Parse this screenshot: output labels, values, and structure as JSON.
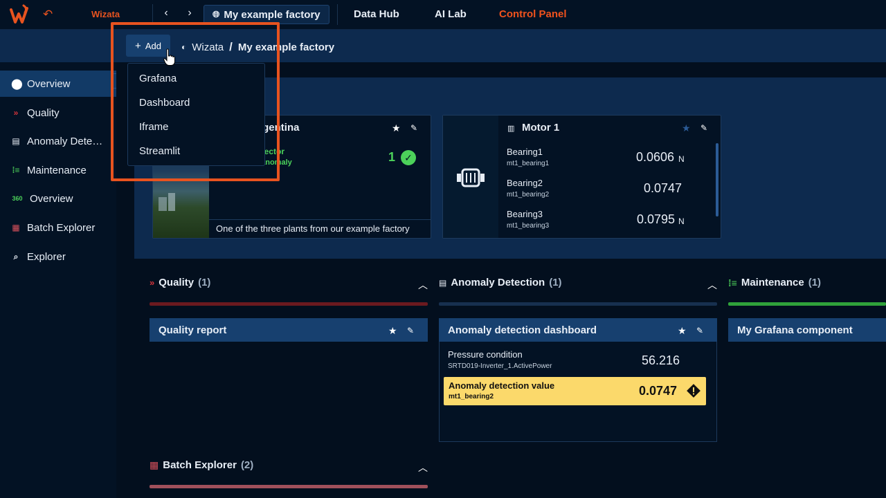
{
  "topbar": {
    "brand": "Wizata",
    "factory": "My example factory",
    "nav": [
      "Data Hub",
      "AI Lab",
      "Control Panel"
    ],
    "accent": "#f0521d"
  },
  "subbar": {
    "add_label": "Add",
    "crumb_root": "Wizata",
    "crumb_sep": "/",
    "crumb_current": "My example factory"
  },
  "dropdown": {
    "items": [
      "Grafana",
      "Dashboard",
      "Iframe",
      "Streamlit"
    ]
  },
  "sidebar": {
    "items": [
      {
        "label": "Overview",
        "icon": "location-pin-icon"
      },
      {
        "label": "Quality",
        "icon": "chevron-double-down-icon"
      },
      {
        "label": "Anomaly Dete…",
        "icon": "anomaly-icon"
      },
      {
        "label": "Maintenance",
        "icon": "maintenance-icon"
      },
      {
        "label": "Overview",
        "icon": "360-icon"
      },
      {
        "label": "Batch Explorer",
        "icon": "batch-icon"
      },
      {
        "label": "Explorer",
        "icon": "explorer-icon"
      }
    ]
  },
  "plant_card": {
    "title": "A: Argentina",
    "tag1": "etector",
    "tag2": "_anomaly",
    "count": "1",
    "description": "One of the three plants from our example factory"
  },
  "motor_card": {
    "title": "Motor 1",
    "metrics": [
      {
        "name": "Bearing1",
        "sub": "mt1_bearing1",
        "value": "0.0606",
        "unit": "N"
      },
      {
        "name": "Bearing2",
        "sub": "mt1_bearing2",
        "value": "0.0747",
        "unit": ""
      },
      {
        "name": "Bearing3",
        "sub": "mt1_bearing3",
        "value": "0.0795",
        "unit": "N"
      }
    ]
  },
  "sections": {
    "quality": {
      "title": "Quality",
      "count": "(1)",
      "color": "#6b1a1f"
    },
    "anomaly": {
      "title": "Anomaly Detection",
      "count": "(1)",
      "color": "#17304f"
    },
    "maintenance": {
      "title": "Maintenance",
      "count": "(1)",
      "color": "#2fa23a"
    },
    "batch": {
      "title": "Batch Explorer",
      "count": "(2)",
      "color": "#a0505b"
    }
  },
  "panels": {
    "quality_report": {
      "title": "Quality report"
    },
    "anomaly_dashboard": {
      "title": "Anomaly detection dashboard",
      "pressure_name": "Pressure condition",
      "pressure_sub": "SRTD019-Inverter_1.ActivePower",
      "pressure_value": "56.216",
      "anomaly_name": "Anomaly detection value",
      "anomaly_sub": "mt1_bearing2",
      "anomaly_value": "0.0747",
      "anomaly_color": "#fbd96b"
    },
    "grafana": {
      "title": "My Grafana component"
    }
  }
}
